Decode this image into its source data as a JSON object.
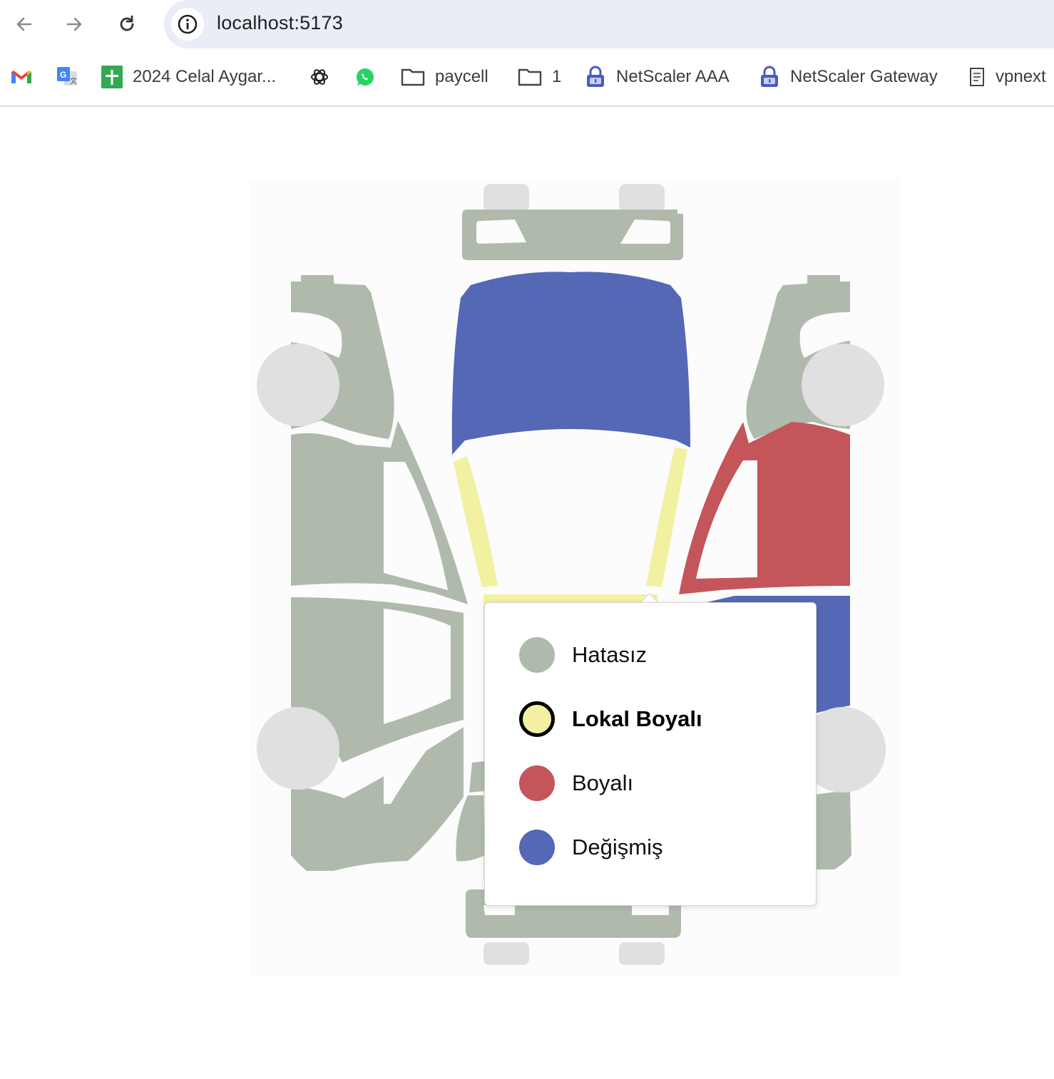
{
  "browser": {
    "url": "localhost:5173",
    "bookmarks": [
      {
        "icon": "gmail-icon",
        "label": ""
      },
      {
        "icon": "google-translate-icon",
        "label": ""
      },
      {
        "icon": "google-sheets-icon",
        "label": "2024 Celal Aygar..."
      },
      {
        "icon": "chatgpt-icon",
        "label": ""
      },
      {
        "icon": "whatsapp-icon",
        "label": ""
      },
      {
        "icon": "folder-icon",
        "label": "paycell"
      },
      {
        "icon": "folder-icon",
        "label": "1"
      },
      {
        "icon": "lock-icon",
        "label": "NetScaler AAA"
      },
      {
        "icon": "lock-icon",
        "label": "NetScaler Gateway"
      },
      {
        "icon": "page-icon",
        "label": "vpnext"
      }
    ]
  },
  "colors": {
    "hatasiz": "#afbaad",
    "lokal_boyali": "#f2f0a1",
    "boyali": "#c4555b",
    "degismis": "#5568b5",
    "tire": "#e0e0e0"
  },
  "car_parts": {
    "front_bumper": "hatasiz",
    "hood": "degismis",
    "roof": "lokal_boyali",
    "left_front_fender": "hatasiz",
    "left_front_door": "hatasiz",
    "left_rear_door": "hatasiz",
    "left_rear_fender": "hatasiz",
    "right_front_fender": "hatasiz",
    "right_front_door": "boyali",
    "right_rear_door": "degismis",
    "right_rear_fender": "hatasiz",
    "trunk": "hatasiz",
    "rear_bumper": "hatasiz"
  },
  "legend": {
    "selected": "lokal_boyali",
    "options": [
      {
        "key": "hatasiz",
        "label": "Hatasız"
      },
      {
        "key": "lokal_boyali",
        "label": "Lokal Boyalı"
      },
      {
        "key": "boyali",
        "label": "Boyalı"
      },
      {
        "key": "degismis",
        "label": "Değişmiş"
      }
    ]
  }
}
